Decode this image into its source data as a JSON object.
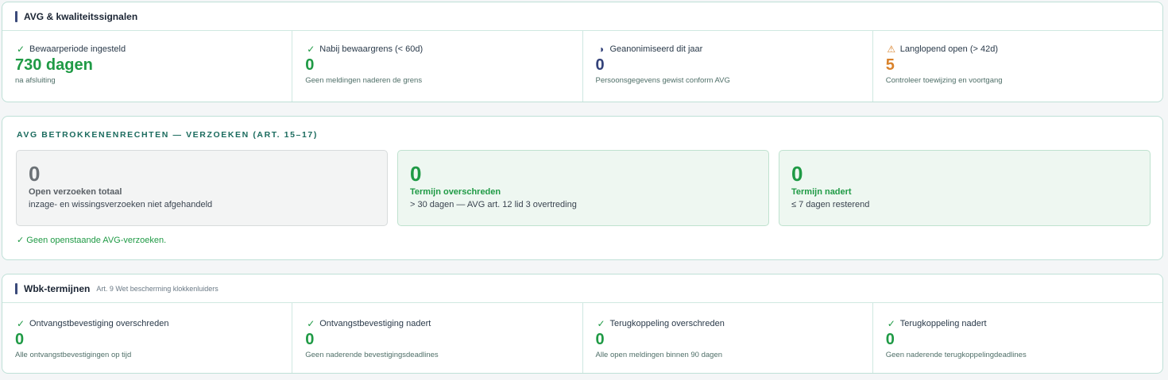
{
  "avg_panel": {
    "title": "AVG & kwaliteitssignalen",
    "kpis": [
      {
        "icon": "check-icon",
        "glyph": "✓",
        "label": "Bewaarperiode ingesteld",
        "value": "730 dagen",
        "sub": "na afsluiting",
        "color": "#1f9a45"
      },
      {
        "icon": "check-icon",
        "glyph": "✓",
        "label": "Nabij bewaargrens (< 60d)",
        "value": "0",
        "sub": "Geen meldingen naderen de grens",
        "color": "#1f9a45"
      },
      {
        "icon": "half-circle-icon",
        "glyph": "◑",
        "label": "Geanonimiseerd dit jaar",
        "value": "0",
        "sub": "Persoonsgegevens gewist conform AVG",
        "color": "#33427a"
      },
      {
        "icon": "warning-icon",
        "glyph": "⚠",
        "label": "Langlopend open (> 42d)",
        "value": "5",
        "sub": "Controleer toewijzing en voortgang",
        "color": "#d9822b"
      }
    ]
  },
  "rights_panel": {
    "title": "AVG BETROKKENENRECHTEN — VERZOEKEN (ART. 15–17)",
    "boxes": [
      {
        "value": "0",
        "label": "Open verzoeken totaal",
        "sub": "inzage- en wissingsverzoeken niet afgehandeld"
      },
      {
        "value": "0",
        "label": "Termijn overschreden",
        "sub": "> 30 dagen — AVG art. 12 lid 3 overtreding"
      },
      {
        "value": "0",
        "label": "Termijn nadert",
        "sub": "≤ 7 dagen resterend"
      }
    ],
    "note": "✓ Geen openstaande AVG-verzoeken."
  },
  "wbk_panel": {
    "title": "Wbk-termijnen",
    "subtitle": "Art. 9 Wet bescherming klokkenluiders",
    "kpis": [
      {
        "icon": "check-icon",
        "glyph": "✓",
        "label": "Ontvangstbevestiging overschreden",
        "value": "0",
        "sub": "Alle ontvangstbevestigingen op tijd"
      },
      {
        "icon": "check-icon",
        "glyph": "✓",
        "label": "Ontvangstbevestiging nadert",
        "value": "0",
        "sub": "Geen naderende bevestigingsdeadlines"
      },
      {
        "icon": "check-icon",
        "glyph": "✓",
        "label": "Terugkoppeling overschreden",
        "value": "0",
        "sub": "Alle open meldingen binnen 90 dagen"
      },
      {
        "icon": "check-icon",
        "glyph": "✓",
        "label": "Terugkoppeling nadert",
        "value": "0",
        "sub": "Geen naderende terugkoppelingdeadlines"
      }
    ]
  },
  "colors": {
    "green": "#1f9a45",
    "navy": "#33427a",
    "orange": "#d9822b",
    "border": "#bfe0d7"
  }
}
